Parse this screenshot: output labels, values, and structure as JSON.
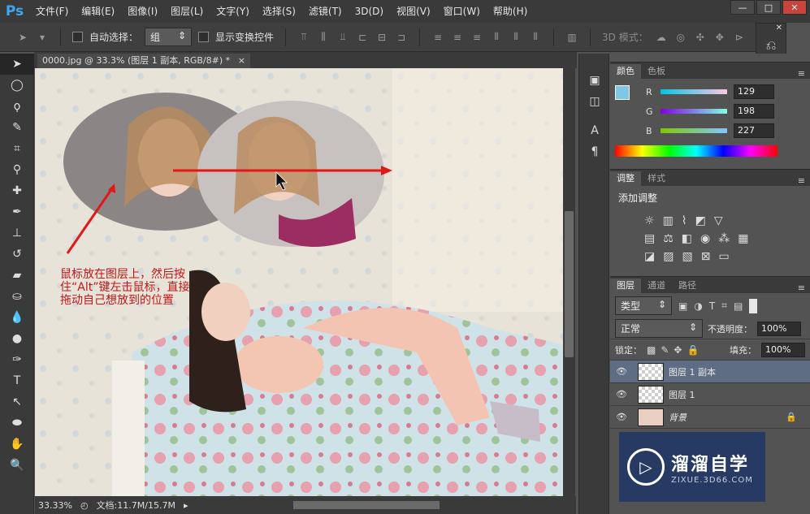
{
  "app": {
    "logo": "Ps",
    "menu": [
      "文件(F)",
      "编辑(E)",
      "图像(I)",
      "图层(L)",
      "文字(Y)",
      "选择(S)",
      "滤镜(T)",
      "3D(D)",
      "视图(V)",
      "窗口(W)",
      "帮助(H)"
    ],
    "window_buttons": {
      "minimize": "—",
      "maximize": "□",
      "close": "✕"
    }
  },
  "options_bar": {
    "auto_select_label": "自动选择：",
    "auto_select_value": "组",
    "show_transform_label": "显示变换控件",
    "mode_3d_label": "3D 模式："
  },
  "document": {
    "tab_title": "0000.jpg @ 33.3% (图层 1 副本, RGB/8#) *",
    "tab_close": "×",
    "zoom": "33.33%",
    "doc_info": "文档:11.7M/15.7M",
    "annotation": "鼠标放在图层上，然后按住“Alt”键左击鼠标，直接拖动自己想放到的位置"
  },
  "color_panel": {
    "tabs": [
      "颜色",
      "色板"
    ],
    "channels": [
      {
        "label": "R",
        "value": "129",
        "fraction": 0.506
      },
      {
        "label": "G",
        "value": "198",
        "fraction": 0.776
      },
      {
        "label": "B",
        "value": "227",
        "fraction": 0.89
      }
    ],
    "foreground": "#81c6e3"
  },
  "adjust_panel": {
    "tabs": [
      "调整",
      "样式"
    ],
    "title": "添加调整"
  },
  "layers_panel": {
    "tabs": [
      "图层",
      "通道",
      "路径"
    ],
    "filter_label": "类型",
    "blend_mode": "正常",
    "opacity_label": "不透明度：",
    "opacity_value": "100%",
    "lock_label": "锁定：",
    "fill_label": "填充：",
    "fill_value": "100%",
    "layers": [
      {
        "name": "图层 1 副本",
        "selected": true
      },
      {
        "name": "图层 1",
        "selected": false
      },
      {
        "name": "背景",
        "selected": false
      }
    ]
  },
  "watermark": {
    "title": "溜溜自学",
    "subtitle": "ZIXUE.3D66.COM"
  }
}
